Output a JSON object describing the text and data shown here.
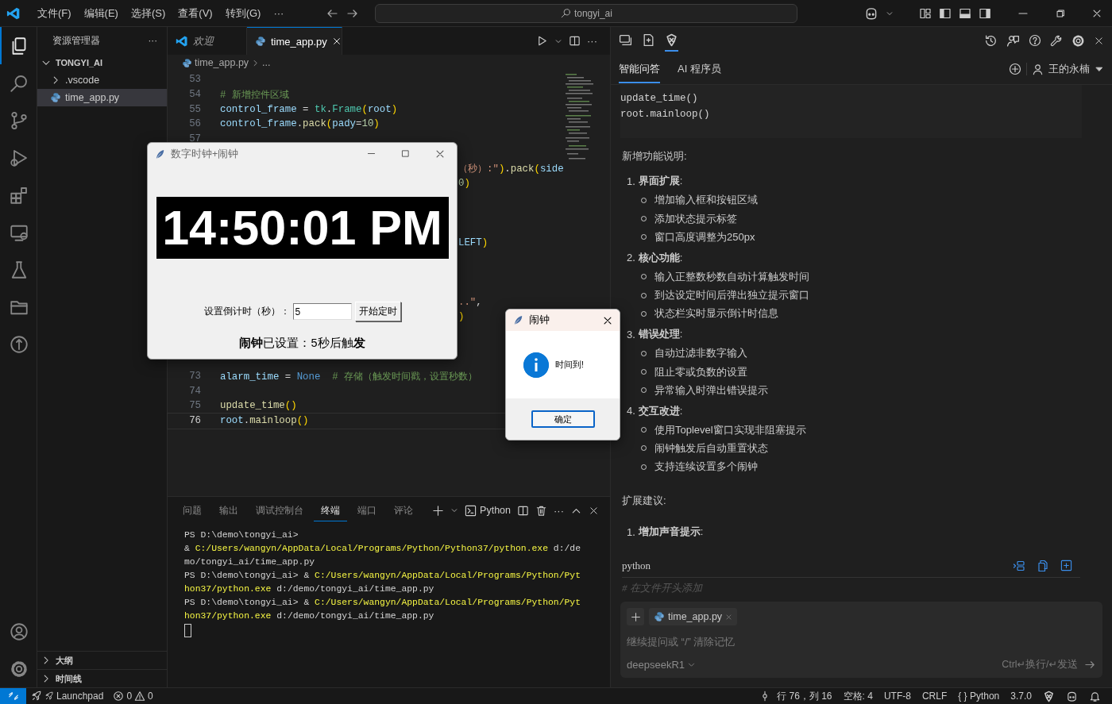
{
  "menu": [
    "文件(F)",
    "编辑(E)",
    "选择(S)",
    "查看(V)",
    "转到(G)"
  ],
  "menu_more": "···",
  "command_center": {
    "label": "tongyi_ai"
  },
  "activity_bar": [
    {
      "kind": "files",
      "selected": true
    },
    {
      "kind": "search",
      "selected": false
    },
    {
      "kind": "branch",
      "selected": false
    },
    {
      "kind": "debug",
      "selected": false
    },
    {
      "kind": "extensions",
      "selected": false
    },
    {
      "kind": "remote",
      "selected": false
    },
    {
      "kind": "flask",
      "selected": false
    },
    {
      "kind": "folder",
      "selected": false
    },
    {
      "kind": "graph",
      "selected": false
    }
  ],
  "activity_bottom": [
    {
      "kind": "account"
    },
    {
      "kind": "gear"
    }
  ],
  "sidebar": {
    "title": "资源管理器",
    "more": "···",
    "tree": [
      {
        "label": "TONGYI_AI",
        "kind": "root",
        "expanded": true,
        "selected": false,
        "children": [
          {
            "label": ".vscode",
            "kind": "folder",
            "expanded": false,
            "selected": false
          },
          {
            "label": "time_app.py",
            "kind": "python",
            "selected": true
          }
        ]
      }
    ],
    "sections": [
      {
        "label": "大纲",
        "expanded": false
      },
      {
        "label": "时间线",
        "expanded": false
      }
    ]
  },
  "editor_tabs": [
    {
      "label": "欢迎",
      "kind": "welcome",
      "selected": false
    },
    {
      "label": "time_app.py",
      "kind": "python",
      "selected": true
    }
  ],
  "editor_more": "···",
  "breadcrumb": [
    "time_app.py",
    "..."
  ],
  "code_lines": [
    {
      "number": "53",
      "current": false
    },
    {
      "number": "54",
      "current": false,
      "tokens": [
        {
          "kind": "comment",
          "text": "# 新增控件区域"
        }
      ]
    },
    {
      "number": "55",
      "current": false,
      "tokens": [
        {
          "kind": "var",
          "text": "control_frame"
        },
        {
          "kind": "plain",
          "text": " = "
        },
        {
          "kind": "class",
          "text": "tk"
        },
        {
          "kind": "plain",
          "text": "."
        },
        {
          "kind": "class",
          "text": "Frame"
        },
        {
          "kind": "punct",
          "text": "("
        },
        {
          "kind": "var",
          "text": "root"
        },
        {
          "kind": "punct",
          "text": ")"
        }
      ]
    },
    {
      "number": "56",
      "current": false,
      "tokens": [
        {
          "kind": "var",
          "text": "control_frame"
        },
        {
          "kind": "plain",
          "text": "."
        },
        {
          "kind": "func",
          "text": "pack"
        },
        {
          "kind": "punct",
          "text": "("
        },
        {
          "kind": "var",
          "text": "pady"
        },
        {
          "kind": "plain",
          "text": "="
        },
        {
          "kind": "num",
          "text": "10"
        },
        {
          "kind": "punct",
          "text": ")"
        }
      ]
    },
    {
      "number": "57",
      "current": false
    },
    {
      "number": "73",
      "current": false,
      "tokens": [
        {
          "kind": "var",
          "text": "alarm_time"
        },
        {
          "kind": "plain",
          "text": " = "
        },
        {
          "kind": "const",
          "text": "None"
        },
        {
          "kind": "comment",
          "text": "  # 存储（触发时间戳，设置秒数）"
        }
      ]
    },
    {
      "number": "74",
      "current": false
    },
    {
      "number": "75",
      "current": false,
      "tokens": [
        {
          "kind": "func",
          "text": "update_time"
        },
        {
          "kind": "punct",
          "text": "()"
        }
      ]
    },
    {
      "number": "76",
      "current": true,
      "tokens": [
        {
          "kind": "var",
          "text": "root"
        },
        {
          "kind": "plain",
          "text": "."
        },
        {
          "kind": "func",
          "text": "mainloop"
        },
        {
          "kind": "punct",
          "text": "()"
        }
      ]
    }
  ],
  "covered_fragments": [
    [
      {
        "kind": "str",
        "text": "（秒）:\""
      },
      {
        "kind": "punct",
        "text": ")"
      },
      {
        "kind": "plain",
        "text": "."
      },
      {
        "kind": "func",
        "text": "pack"
      },
      {
        "kind": "punct",
        "text": "("
      },
      {
        "kind": "var",
        "text": "side"
      }
    ],
    [
      {
        "kind": "num",
        "text": "0"
      },
      {
        "kind": "punct",
        "text": ")"
      }
    ],
    [
      {
        "kind": "var",
        "text": "LEFT"
      },
      {
        "kind": "punct",
        "text": ")"
      }
    ],
    [
      {
        "kind": "str",
        "text": "..\""
      },
      {
        "kind": "plain",
        "text": ","
      }
    ],
    [
      {
        "kind": "punct",
        "text": ")"
      }
    ]
  ],
  "panel": {
    "tabs": [
      {
        "label": "问题",
        "selected": false
      },
      {
        "label": "输出",
        "selected": false
      },
      {
        "label": "调试控制台",
        "selected": false
      },
      {
        "label": "终端",
        "selected": true
      },
      {
        "label": "端口",
        "selected": false
      },
      {
        "label": "评论",
        "selected": false
      }
    ],
    "profile": "Python",
    "more": "···",
    "lines": [
      [
        {
          "kind": "plain",
          "text": "PS D:\\demo\\tongyi_ai>"
        }
      ],
      [
        {
          "kind": "plain",
          "text": "& "
        },
        {
          "kind": "path",
          "text": "C:/Users/wangyn/AppData/Local/Programs/Python/Python37/python.exe"
        },
        {
          "kind": "plain",
          "text": " d:/de"
        }
      ],
      [
        {
          "kind": "plain",
          "text": "mo/tongyi_ai/time_app.py"
        }
      ],
      [
        {
          "kind": "plain",
          "text": "PS D:\\demo\\tongyi_ai> & "
        },
        {
          "kind": "path",
          "text": "C:/Users/wangyn/AppData/Local/Programs/Python/Pyt"
        }
      ],
      [
        {
          "kind": "path",
          "text": "hon37/python.exe"
        },
        {
          "kind": "plain",
          "text": " d:/demo/tongyi_ai/time_app.py"
        }
      ],
      [
        {
          "kind": "plain",
          "text": "PS D:\\demo\\tongyi_ai> & "
        },
        {
          "kind": "path",
          "text": "C:/Users/wangyn/AppData/Local/Programs/Python/Pyt"
        }
      ],
      [
        {
          "kind": "path",
          "text": "hon37/python.exe"
        },
        {
          "kind": "plain",
          "text": " d:/demo/tongyi_ai/time_app.py"
        }
      ]
    ]
  },
  "assistant": {
    "top_icons": [
      {
        "kind": "chat",
        "selected": false
      },
      {
        "kind": "doc",
        "selected": false
      },
      {
        "kind": "logo",
        "selected": true
      }
    ],
    "tabs": [
      {
        "label": "智能问答",
        "selected": true
      },
      {
        "label": "AI 程序员",
        "selected": false
      }
    ],
    "user": "王的永楠",
    "code_lines": [
      "update_time()",
      "root.mainloop()"
    ],
    "heading": "新增功能说明:",
    "sections": [
      {
        "number": "1.",
        "title": "**界面扩展**:",
        "bullets": [
          "增加输入框和按钮区域",
          "添加状态提示标签",
          "窗口高度调整为250px"
        ]
      },
      {
        "number": "2.",
        "title": "**核心功能**:",
        "bullets": [
          "输入正整数秒数自动计算触发时间",
          "到达设定时间后弹出独立提示窗口",
          "状态栏实时显示倒计时信息"
        ]
      },
      {
        "number": "3.",
        "title": "**错误处理**:",
        "bullets": [
          "自动过滤非数字输入",
          "阻止零或负数的设置",
          "异常输入时弹出错误提示"
        ]
      },
      {
        "number": "4.",
        "title": "**交互改进**:",
        "bullets": [
          "使用Toplevel窗口实现非阻塞提示",
          "闹钟触发后自动重置状态",
          "支持连续设置多个闹钟"
        ]
      }
    ],
    "heading2": "扩展建议:",
    "sections2": [
      {
        "number": "1.",
        "title": "**增加声音提示**:"
      }
    ],
    "code_language": "python",
    "code_first_line": "# 在文件开头添加",
    "context_file": "time_app.py",
    "input": {
      "placeholder": "继续提问或 “/” 清除记忆"
    },
    "model": "deepseekR1",
    "send_hint": "Ctrl↵换行/↵发送"
  },
  "status_bar": {
    "launchpad": "Launchpad",
    "errors": "0",
    "warnings": "0",
    "position": "行 76，列 16",
    "spaces": "空格: 4",
    "encoding": "UTF-8",
    "eol": "CRLF",
    "language_icon": "{ }",
    "language": "Python",
    "version": "3.7.0"
  },
  "clock_window": {
    "title": "数字时钟+闹钟",
    "time": "14:50:01 PM",
    "label": "设置倒计时（秒）：",
    "entry_value": "5",
    "button": "开始定时",
    "status": "**闹钟**已设置：5秒后触**发**"
  },
  "dialog": {
    "title": "闹钟",
    "message": "时间到!",
    "button": "确定"
  }
}
